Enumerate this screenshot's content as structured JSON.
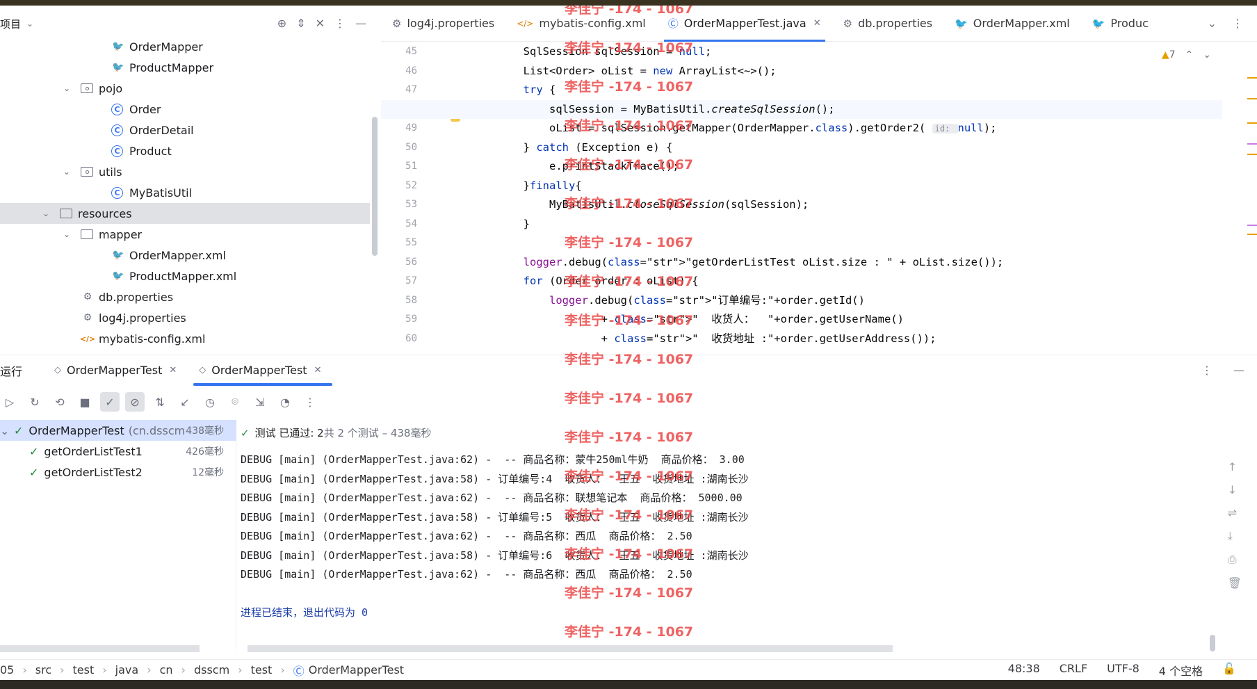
{
  "project": {
    "title": "项目",
    "tree": [
      {
        "label": "OrderMapper",
        "icon": "mybatis-icon",
        "indent": 2
      },
      {
        "label": "ProductMapper",
        "icon": "mybatis-icon",
        "indent": 2
      },
      {
        "label": "pojo",
        "icon": "package-icon",
        "indent": 1,
        "expanded": true
      },
      {
        "label": "Order",
        "icon": "class-icon",
        "indent": 2
      },
      {
        "label": "OrderDetail",
        "icon": "class-icon",
        "indent": 2
      },
      {
        "label": "Product",
        "icon": "class-icon",
        "indent": 2
      },
      {
        "label": "utils",
        "icon": "package-icon",
        "indent": 1,
        "expanded": true
      },
      {
        "label": "MyBatisUtil",
        "icon": "class-icon",
        "indent": 2
      },
      {
        "label": "resources",
        "icon": "resources-folder-icon",
        "indent": 0,
        "expanded": true,
        "selected": true
      },
      {
        "label": "mapper",
        "icon": "folder-icon",
        "indent": 1,
        "expanded": true
      },
      {
        "label": "OrderMapper.xml",
        "icon": "mybatis-icon",
        "indent": 2
      },
      {
        "label": "ProductMapper.xml",
        "icon": "mybatis-icon",
        "indent": 2
      },
      {
        "label": "db.properties",
        "icon": "settings-file-icon",
        "indent": 1
      },
      {
        "label": "log4j.properties",
        "icon": "settings-file-icon",
        "indent": 1
      },
      {
        "label": "mybatis-config.xml",
        "icon": "xml-icon",
        "indent": 1
      }
    ]
  },
  "editor_tabs": [
    {
      "label": "log4j.properties",
      "icon": "settings-file-icon"
    },
    {
      "label": "mybatis-config.xml",
      "icon": "xml-icon"
    },
    {
      "label": "OrderMapperTest.java",
      "icon": "class-icon",
      "active": true
    },
    {
      "label": "db.properties",
      "icon": "settings-file-icon"
    },
    {
      "label": "OrderMapper.xml",
      "icon": "mybatis-icon"
    },
    {
      "label": "Produc",
      "icon": "mybatis-icon"
    }
  ],
  "editor": {
    "warnings": "7",
    "current_line": 48,
    "line_numbers": [
      "45",
      "46",
      "47",
      "48",
      "49",
      "50",
      "51",
      "52",
      "53",
      "54",
      "55",
      "56",
      "57",
      "58",
      "59",
      "60"
    ],
    "lines": [
      "        SqlSession sqlSession = null;",
      "        List<Order> oList = new ArrayList<~>();",
      "        try {",
      "            sqlSession = MyBatisUtil.createSqlSession();",
      "            oList = sqlSession.getMapper(OrderMapper.class).getOrder2( id: null);",
      "        } catch (Exception e) {",
      "            e.printStackTrace();",
      "        }finally{",
      "            MyBatisUtil.closeSqlSession(sqlSession);",
      "        }",
      "",
      "        logger.debug(\"getOrderListTest oList.size : \" + oList.size());",
      "        for (Order order : oList) {",
      "            logger.debug(\"订单编号:\"+order.getId()",
      "                    + \"  收货人：  \"+order.getUserName()",
      "                    + \"  收货地址 :\"+order.getUserAddress());"
    ]
  },
  "run": {
    "label": "运行",
    "tabs": [
      {
        "label": "OrderMapperTest"
      },
      {
        "label": "OrderMapperTest",
        "active": true
      }
    ],
    "tests": [
      {
        "label": "OrderMapperTest",
        "pkg": "(cn.dsscm",
        "duration": "438毫秒",
        "root": true
      },
      {
        "label": "getOrderListTest1",
        "duration": "426毫秒"
      },
      {
        "label": "getOrderListTest2",
        "duration": "12毫秒"
      }
    ],
    "status_main": "测试 已通过: 2",
    "status_sub": "共 2 个测试 – 438毫秒",
    "console": [
      "DEBUG [main] (OrderMapperTest.java:62) -  -- 商品名称：蒙牛250ml牛奶  商品价格： 3.00",
      "DEBUG [main] (OrderMapperTest.java:58) - 订单编号:4  收货人：  王五  收货地址 :湖南长沙",
      "DEBUG [main] (OrderMapperTest.java:62) -  -- 商品名称：联想笔记本  商品价格： 5000.00",
      "DEBUG [main] (OrderMapperTest.java:58) - 订单编号:5  收货人：  王五  收货地址 :湖南长沙",
      "DEBUG [main] (OrderMapperTest.java:62) -  -- 商品名称：西瓜  商品价格： 2.50",
      "DEBUG [main] (OrderMapperTest.java:58) - 订单编号:6  收货人：  王五  收货地址 :湖南长沙",
      "DEBUG [main] (OrderMapperTest.java:62) -  -- 商品名称：西瓜  商品价格： 2.50",
      "",
      "进程已结束，退出代码为 0"
    ]
  },
  "statusbar": {
    "breadcrumb": [
      "05",
      "src",
      "test",
      "java",
      "cn",
      "dsscm",
      "test",
      "OrderMapperTest"
    ],
    "position": "48:38",
    "line_sep": "CRLF",
    "encoding": "UTF-8",
    "indent": "4 个空格"
  },
  "watermark": "李佳宁 -174 - 1067"
}
